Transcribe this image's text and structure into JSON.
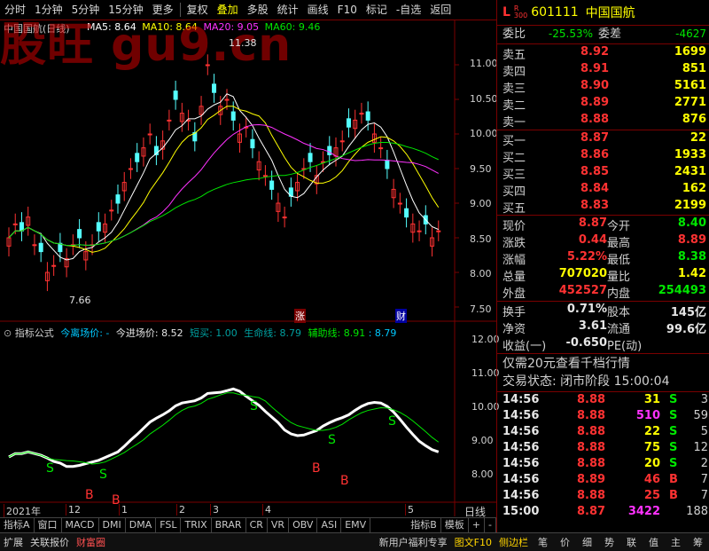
{
  "toolbar": {
    "items": [
      "分时",
      "1分钟",
      "5分钟",
      "15分钟",
      "更多",
      "复权",
      "叠加",
      "多股",
      "统计",
      "画线",
      "F10",
      "标记",
      "-自选",
      "返回"
    ],
    "active_index": 6
  },
  "watermark": "股旺 gu9.cn",
  "main_chart": {
    "title": "中国国航(日线)",
    "ma5": "MA5: 8.64",
    "ma10": "MA10: 8.64",
    "ma20": "MA20: 9.05",
    "ma60": "MA60: 9.46",
    "high_label": "11.38",
    "low_label": "7.66",
    "y_ticks": [
      "11.00",
      "10.50",
      "10.00",
      "9.50",
      "9.00",
      "8.50",
      "8.00",
      "7.50"
    ],
    "markers": [
      "涨",
      "财"
    ]
  },
  "indicator": {
    "name": "指标公式",
    "field1": "今离场价: -",
    "field2": "今进场价: 8.52",
    "field3": "短买: 1.00",
    "field4": "生命线: 8.79",
    "field5": "辅助线: 8.91",
    "field6": ": 8.79",
    "y_ticks": [
      "12.00",
      "11.00",
      "10.00",
      "9.00",
      "8.00"
    ],
    "signals_s": [
      "S",
      "S",
      "S",
      "S",
      "S"
    ],
    "signals_b": [
      "B",
      "B",
      "B",
      "B"
    ]
  },
  "x_axis": {
    "labels": [
      "2021年",
      "12",
      "1",
      "2",
      "3",
      "4",
      "5"
    ],
    "period": "日线"
  },
  "tabs": [
    "指标A",
    "窗口",
    "MACD",
    "DMI",
    "DMA",
    "FSL",
    "TRIX",
    "BRAR",
    "CR",
    "VR",
    "OBV",
    "ASI",
    "EMV",
    "指标B",
    "模板",
    "+",
    "-"
  ],
  "bottom": [
    "扩展",
    "关联报价",
    "财富圈",
    "新用户福利专享",
    "图文F10",
    "侧边栏"
  ],
  "bottom_right_icons": [
    "笔",
    "价",
    "细",
    "势",
    "联",
    "值",
    "主",
    "筹"
  ],
  "quote": {
    "code": "601111",
    "name": "中国国航",
    "tag": "L",
    "tag2": "R\n300",
    "weibi_label": "委比",
    "weibi": "-25.53%",
    "weicha_label": "委差",
    "weicha": "-4627",
    "asks": [
      {
        "label": "卖五",
        "price": "8.92",
        "vol": "1699"
      },
      {
        "label": "卖四",
        "price": "8.91",
        "vol": "851"
      },
      {
        "label": "卖三",
        "price": "8.90",
        "vol": "5161"
      },
      {
        "label": "卖二",
        "price": "8.89",
        "vol": "2771"
      },
      {
        "label": "卖一",
        "price": "8.88",
        "vol": "876"
      }
    ],
    "bids": [
      {
        "label": "买一",
        "price": "8.87",
        "vol": "22"
      },
      {
        "label": "买二",
        "price": "8.86",
        "vol": "1933"
      },
      {
        "label": "买三",
        "price": "8.85",
        "vol": "2431"
      },
      {
        "label": "买四",
        "price": "8.84",
        "vol": "162"
      },
      {
        "label": "买五",
        "price": "8.83",
        "vol": "2199"
      }
    ],
    "stats": [
      {
        "l1": "现价",
        "v1": "8.87",
        "l2": "今开",
        "v2": "8.40"
      },
      {
        "l1": "涨跌",
        "v1": "0.44",
        "l2": "最高",
        "v2": "8.89"
      },
      {
        "l1": "涨幅",
        "v1": "5.22%",
        "l2": "最低",
        "v2": "8.38"
      },
      {
        "l1": "总量",
        "v1": "707020",
        "l2": "量比",
        "v2": "1.42"
      },
      {
        "l1": "外盘",
        "v1": "452527",
        "l2": "内盘",
        "v2": "254493"
      }
    ],
    "stats2": [
      {
        "l1": "换手",
        "v1": "0.71%",
        "l2": "股本",
        "v2": "145亿"
      },
      {
        "l1": "净资",
        "v1": "3.61",
        "l2": "流通",
        "v2": "99.6亿"
      },
      {
        "l1": "收益(一)",
        "v1": "-0.650",
        "l2": "PE(动)",
        "v2": ""
      }
    ],
    "promo": "仅需20元查看千档行情",
    "status": "交易状态: 闭市阶段 15:00:04",
    "ticks": [
      {
        "t": "14:56",
        "p": "8.88",
        "v": "31",
        "d": "S",
        "n": "3"
      },
      {
        "t": "14:56",
        "p": "8.88",
        "v": "510",
        "d": "S",
        "n": "59"
      },
      {
        "t": "14:56",
        "p": "8.88",
        "v": "22",
        "d": "S",
        "n": "5"
      },
      {
        "t": "14:56",
        "p": "8.88",
        "v": "75",
        "d": "S",
        "n": "12"
      },
      {
        "t": "14:56",
        "p": "8.88",
        "v": "20",
        "d": "S",
        "n": "2"
      },
      {
        "t": "14:56",
        "p": "8.89",
        "v": "46",
        "d": "B",
        "n": "7"
      },
      {
        "t": "14:56",
        "p": "8.88",
        "v": "25",
        "d": "B",
        "n": "7"
      },
      {
        "t": "15:00",
        "p": "8.87",
        "v": "3422",
        "d": "",
        "n": "188"
      }
    ]
  }
}
